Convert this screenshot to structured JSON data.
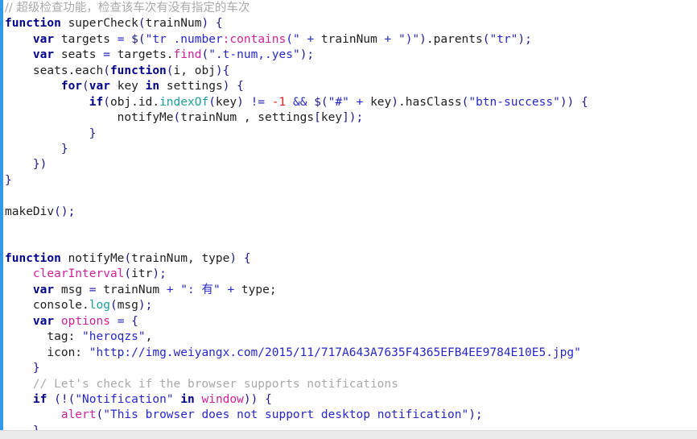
{
  "app": {
    "kind": "code-snippet-viewer",
    "language": "javascript",
    "background_color": "#ffffff",
    "gutter_accent_color": "#3399e6",
    "bottom_strip_color": "#ececec"
  },
  "palette": {
    "plain": "#202020",
    "keyword": "#00008b",
    "string": "#2727c9",
    "comment": "#a8a8a8",
    "function": "#cc2299",
    "method": "#1d9c9c",
    "number": "#d62020"
  },
  "code": {
    "lines": [
      "// 超级检查功能，检查该车次有没有指定的车次",
      "function superCheck(trainNum) {",
      "    var targets = $(\"tr .number:contains(\" + trainNum + \")\").parents(\"tr\");",
      "    var seats = targets.find(\".t-num,.yes\");",
      "    seats.each(function(i, obj){",
      "        for(var key in settings) {",
      "            if(obj.id.indexOf(key) != -1 && $(\"#\" + key).hasClass(\"btn-success\")) {",
      "                notifyMe(trainNum , settings[key]);",
      "            }",
      "        }",
      "    })",
      "}",
      "",
      "makeDiv();",
      "",
      "",
      "function notifyMe(trainNum, type) {",
      "    clearInterval(itr);",
      "    var msg = trainNum + \": 有\" + type;",
      "    console.log(msg);",
      "    var options = {",
      "      tag: \"heroqzs\",",
      "      icon: \"http://img.weiyangx.com/2015/11/717A643A7635F4365EFB4EE9784E10E5.jpg\"",
      "    }",
      "    // Let's check if the browser supports notifications",
      "    if (!(\"Notification\" in window)) {",
      "        alert(\"This browser does not support desktop notification\");",
      "    }"
    ],
    "tokens": {
      "comment_1": "// 超级检查功能，检查该车次有没有指定的车次",
      "comment_2": "// Let's check if the browser supports notifications",
      "keywords": [
        "function",
        "var",
        "for",
        "in",
        "if"
      ],
      "functions": [
        "superCheck",
        "notifyMe",
        "makeDiv",
        "find",
        "clearInterval",
        "alert",
        "options",
        "window",
        "parents",
        "hasClass",
        "each"
      ],
      "methods": [
        "indexOf",
        "log"
      ],
      "strings": [
        "\"tr .number:contains(\"",
        "\")\"",
        "\"tr\"",
        "\".t-num,.yes\"",
        "\"#\"",
        "\"btn-success\"",
        "\": 有\"",
        "\"heroqzs\"",
        "\"http://img.weiyangx.com/2015/11/717A643A7635F4365EFB4EE9784E10E5.jpg\"",
        "\"Notification\"",
        "\"This browser does not support desktop notification\""
      ],
      "numbers": [
        "-1"
      ],
      "identifiers": [
        "trainNum",
        "targets",
        "seats",
        "obj",
        "key",
        "settings",
        "itr",
        "msg",
        "type",
        "console",
        "tag",
        "icon",
        "i"
      ]
    }
  }
}
